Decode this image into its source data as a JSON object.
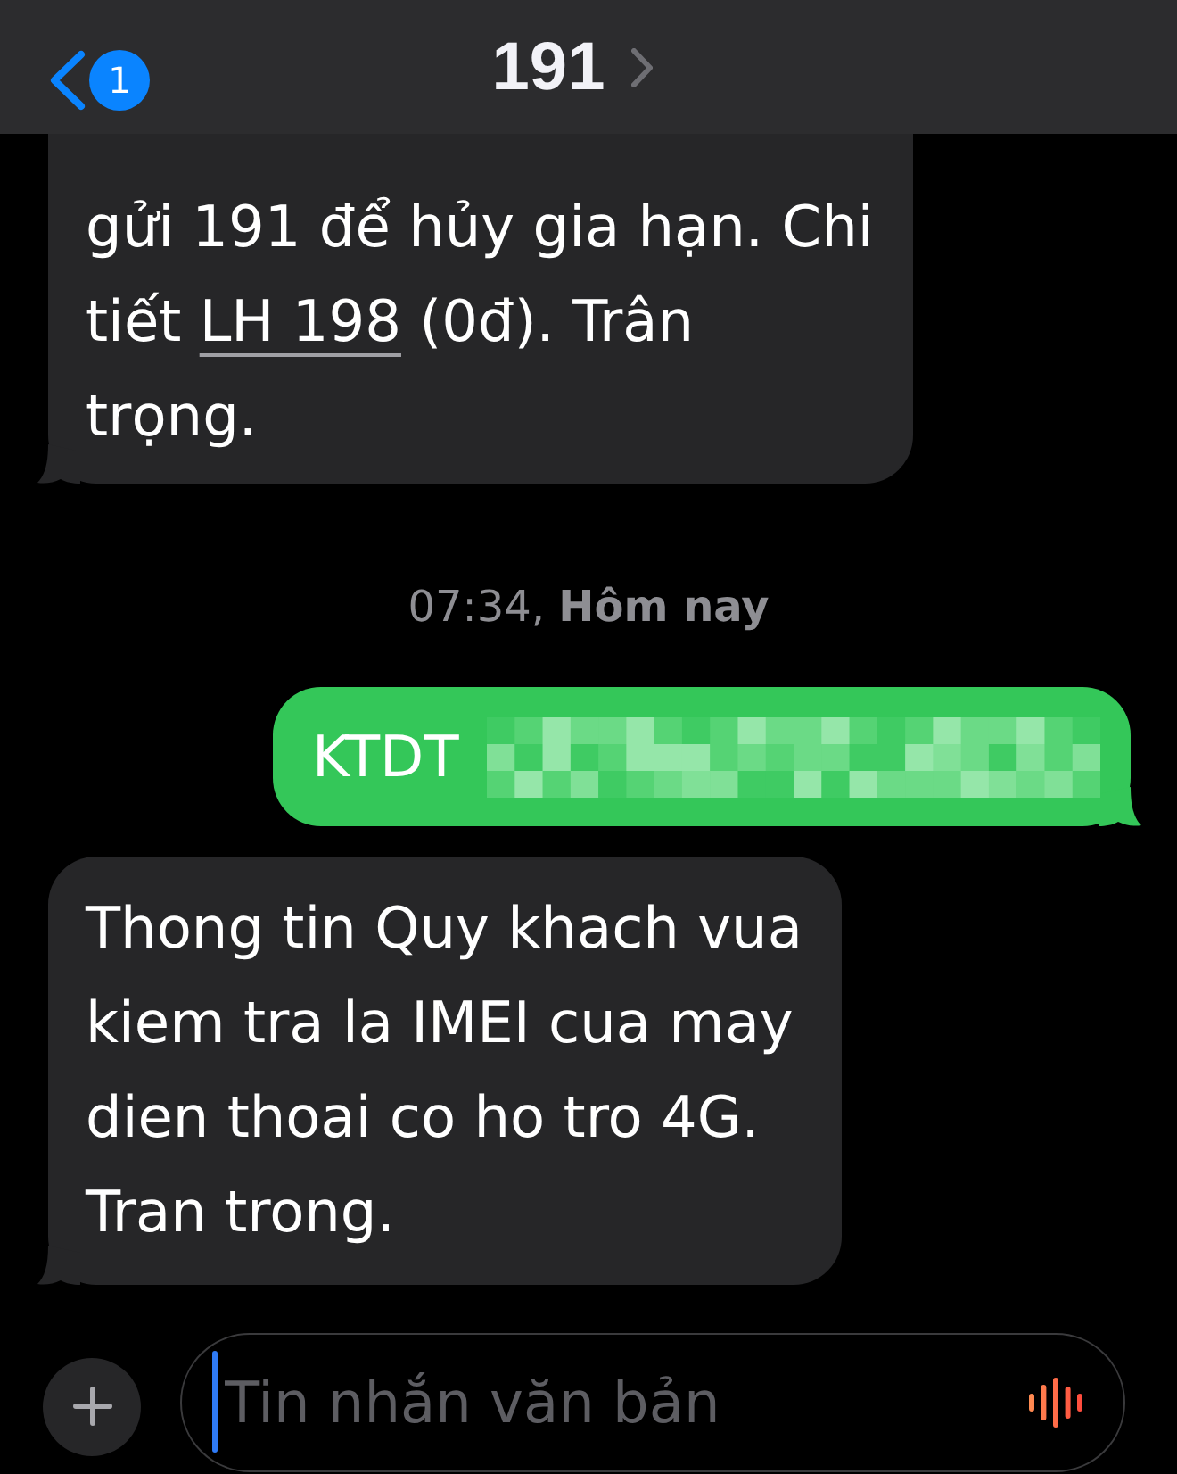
{
  "header": {
    "back_badge": "1",
    "title": "191"
  },
  "messages": [
    {
      "kind": "received",
      "redacted": false,
      "segments": [
        {
          "kind": "text",
          "text": "gửi 191 để hủy gia hạn. Chi tiết "
        },
        {
          "kind": "link",
          "text": "LH 198"
        },
        {
          "kind": "text",
          "text": " (0đ). Trân trọng."
        }
      ]
    },
    {
      "kind": "timestamp",
      "text": "07:34, **Hôm nay**"
    },
    {
      "kind": "sent",
      "redacted": true,
      "segments": [
        {
          "kind": "text",
          "text": "KTDT"
        }
      ]
    },
    {
      "kind": "received",
      "redacted": false,
      "segments": [
        {
          "kind": "text",
          "text": "Thong tin Quy khach vua kiem tra la IMEI cua may dien thoai co ho tro 4G. Tran trong."
        }
      ]
    }
  ],
  "composer": {
    "placeholder": "Tin nhắn văn bản"
  }
}
